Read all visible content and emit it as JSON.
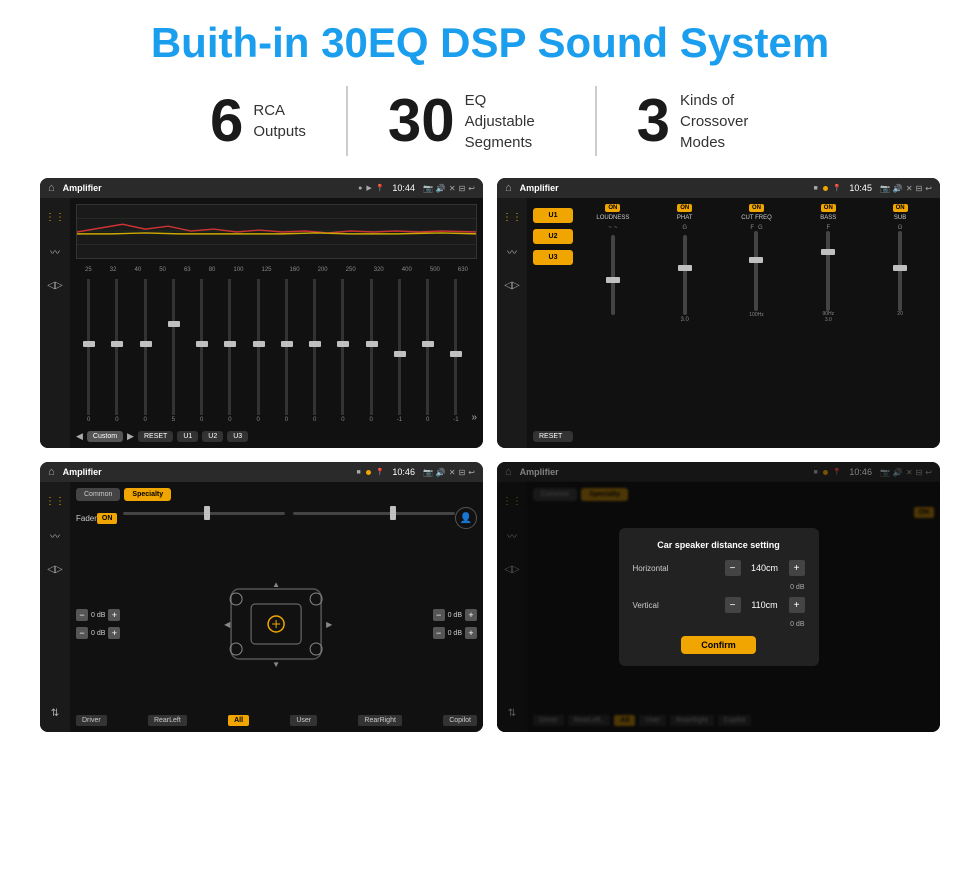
{
  "header": {
    "title": "Buith-in 30EQ DSP Sound System"
  },
  "features": [
    {
      "number": "6",
      "text_line1": "RCA",
      "text_line2": "Outputs"
    },
    {
      "number": "30",
      "text_line1": "EQ Adjustable",
      "text_line2": "Segments"
    },
    {
      "number": "3",
      "text_line1": "Kinds of",
      "text_line2": "Crossover Modes"
    }
  ],
  "screens": {
    "eq_screen": {
      "status": {
        "title": "Amplifier",
        "time": "10:44"
      },
      "freqs": [
        "25",
        "32",
        "40",
        "50",
        "63",
        "80",
        "100",
        "125",
        "160",
        "200",
        "250",
        "320",
        "400",
        "500",
        "630"
      ],
      "values": [
        "0",
        "0",
        "0",
        "5",
        "0",
        "0",
        "0",
        "0",
        "0",
        "0",
        "0",
        "-1",
        "0",
        "-1"
      ],
      "bottom_btns": [
        "Custom",
        "RESET",
        "U1",
        "U2",
        "U3"
      ]
    },
    "crossover_screen": {
      "status": {
        "title": "Amplifier",
        "time": "10:45"
      },
      "presets": [
        "U1",
        "U2",
        "U3"
      ],
      "controls": [
        "LOUDNESS",
        "PHAT",
        "CUT FREQ",
        "BASS",
        "SUB"
      ],
      "reset_label": "RESET"
    },
    "fader_screen": {
      "status": {
        "title": "Amplifier",
        "time": "10:46"
      },
      "tabs": [
        "Common",
        "Specialty"
      ],
      "fader_label": "Fader",
      "on_label": "ON",
      "bottom_btns": [
        "Driver",
        "RearLeft",
        "All",
        "User",
        "RearRight",
        "Copilot"
      ],
      "db_values": [
        "0 dB",
        "0 dB",
        "0 dB",
        "0 dB"
      ]
    },
    "dialog_screen": {
      "status": {
        "title": "Amplifier",
        "time": "10:46"
      },
      "tabs": [
        "Common",
        "Specialty"
      ],
      "dialog": {
        "title": "Car speaker distance setting",
        "horizontal_label": "Horizontal",
        "horizontal_value": "140cm",
        "vertical_label": "Vertical",
        "vertical_value": "110cm",
        "confirm_label": "Confirm",
        "minus_label": "−",
        "plus_label": "+"
      },
      "db_values": [
        "0 dB",
        "0 dB"
      ],
      "bottom_btns": [
        "Driver",
        "RearLeft..",
        "All",
        "User",
        "RearRight",
        "Copilot"
      ]
    }
  }
}
